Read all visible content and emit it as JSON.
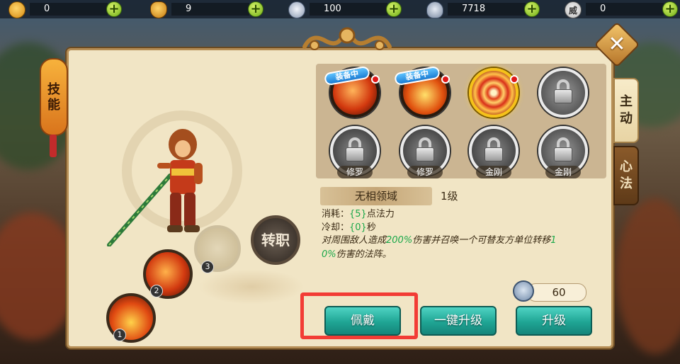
{
  "resources": [
    {
      "icon": "monkey-coin-icon",
      "value": "0"
    },
    {
      "icon": "money-bag-icon",
      "value": "9"
    },
    {
      "icon": "silver-ingot-icon",
      "value": "100"
    },
    {
      "icon": "spirit-ingot-icon",
      "value": "7718"
    },
    {
      "icon": "prestige-icon",
      "value": "0",
      "glyph": "威"
    }
  ],
  "panel": {
    "title_tab": "技能",
    "side_tabs": [
      {
        "label": "主动",
        "active": true
      },
      {
        "label": "心法",
        "active": false
      }
    ]
  },
  "character": {
    "skill_slots": [
      {
        "num": "1"
      },
      {
        "num": "2"
      },
      {
        "num": "3"
      }
    ],
    "transfer_label": "转职"
  },
  "skills": [
    {
      "name": "skill-flame-slash",
      "equipped_badge": "装备中",
      "has_red_dot": true,
      "locked": false
    },
    {
      "name": "skill-fire-pillar",
      "equipped_badge": "装备中",
      "has_red_dot": true,
      "locked": false
    },
    {
      "name": "skill-wuxiang-domain",
      "has_red_dot": true,
      "locked": false,
      "selected": true
    },
    {
      "name": "skill-locked",
      "locked": true,
      "lock_label": ""
    },
    {
      "name": "skill-locked",
      "locked": true,
      "lock_label": "修罗"
    },
    {
      "name": "skill-locked",
      "locked": true,
      "lock_label": "修罗"
    },
    {
      "name": "skill-locked",
      "locked": true,
      "lock_label": "金刚"
    },
    {
      "name": "skill-locked",
      "locked": true,
      "lock_label": "金刚"
    }
  ],
  "detail": {
    "name": "无相领域",
    "level": "1级",
    "cost_prefix": "消耗：",
    "cost_value": "{5}",
    "cost_suffix": "点法力",
    "cooldown_prefix": "冷却：",
    "cooldown_value": "{0}",
    "cooldown_suffix": "秒",
    "desc_part1": "对周围敌人造成",
    "desc_highlight1": "200%",
    "desc_part2": "伤害并召唤一个可替友方单位转移",
    "desc_highlight2a": "1",
    "desc_highlight2b": "0%",
    "desc_part3": "伤害的法阵。"
  },
  "upgrade_cost": "60",
  "buttons": {
    "wear": "佩戴",
    "one_click_upgrade": "一键升级",
    "upgrade": "升级"
  },
  "colors": {
    "accent_green": "#1ba84a",
    "button_teal": "#1fa594",
    "highlight_red": "#f23c35"
  }
}
